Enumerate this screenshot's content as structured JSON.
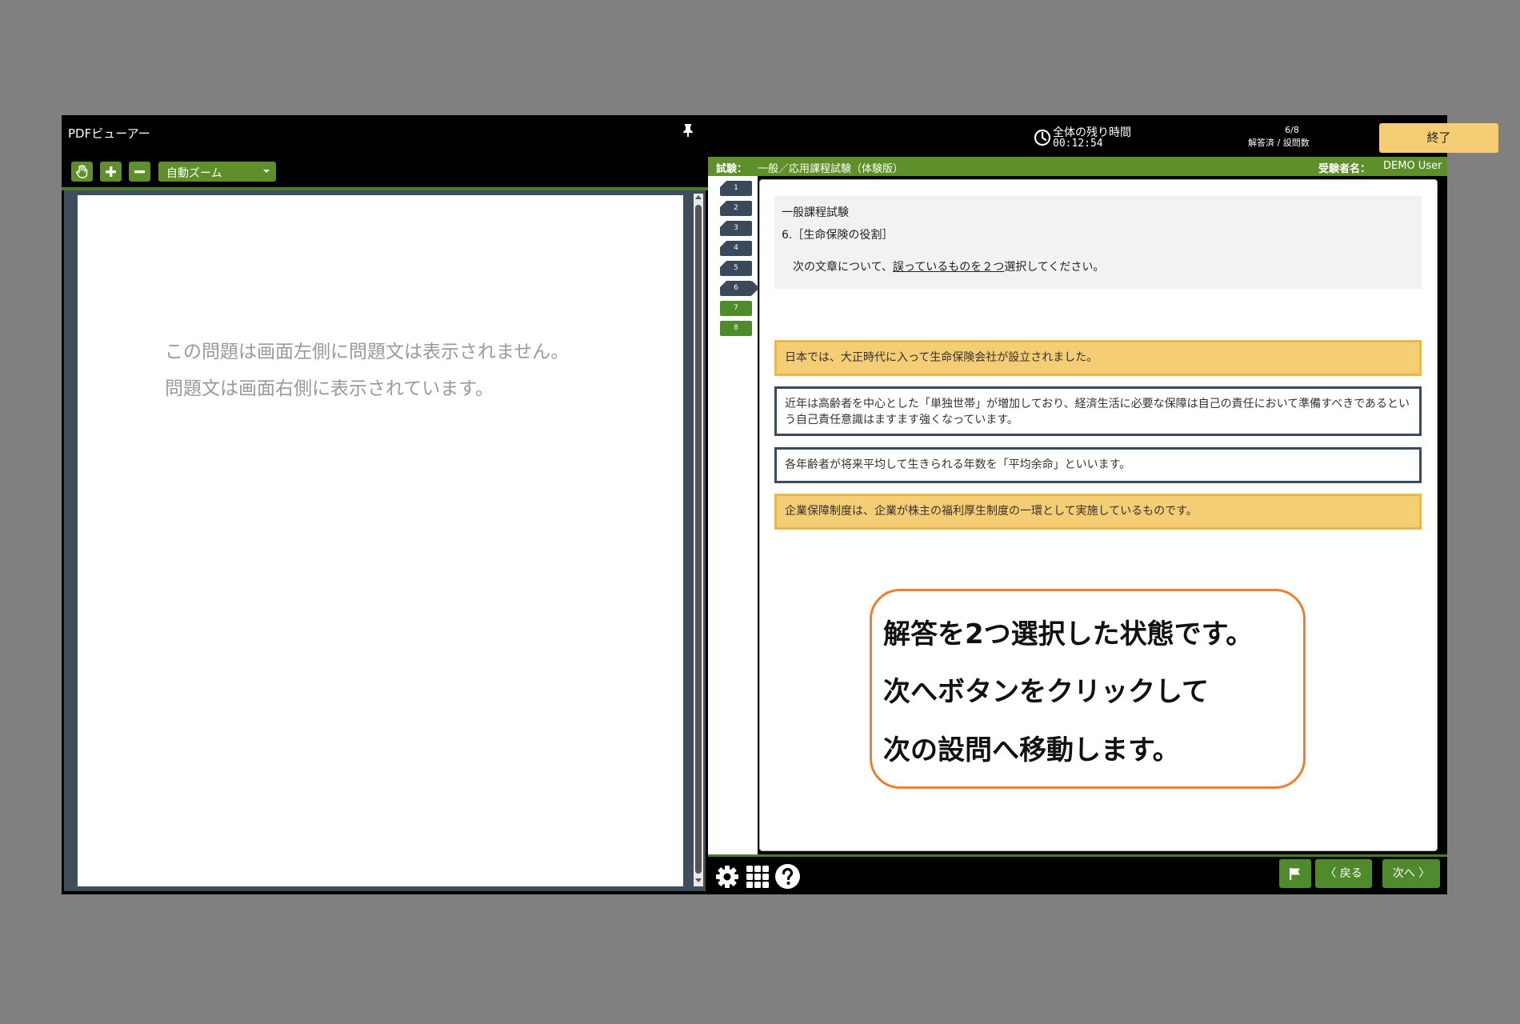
{
  "pdf_viewer": {
    "title": "PDFビューアー",
    "zoom_select": "自動ズーム",
    "message_line1": "この問題は画面左側に問題文は表示されません。",
    "message_line2": "問題文は画面右側に表示されています。"
  },
  "header": {
    "timer_label": "全体の残り時間",
    "timer_value": "00:12:54",
    "progress_count": "6/8",
    "progress_label": "解答済 / 設問数",
    "end_button": "終了"
  },
  "exam_bar": {
    "exam_label": "試験：",
    "exam_name": "一般／応用課程試験（体験版）",
    "examinee_label": "受験者名：",
    "examinee_name": "DEMO User"
  },
  "question_nav": [
    {
      "label": "1",
      "state": "answered"
    },
    {
      "label": "2",
      "state": "answered"
    },
    {
      "label": "3",
      "state": "answered"
    },
    {
      "label": "4",
      "state": "answered"
    },
    {
      "label": "5",
      "state": "answered"
    },
    {
      "label": "6",
      "state": "current"
    },
    {
      "label": "7",
      "state": "pending"
    },
    {
      "label": "8",
      "state": "pending"
    }
  ],
  "question": {
    "category": "一般課程試験",
    "title": "6.［生命保険の役割］",
    "instruction_before": "次の文章について、",
    "instruction_underline": "誤っているものを２つ",
    "instruction_after": "選択してください。"
  },
  "options": [
    {
      "text": "日本では、大正時代に入って生命保険会社が設立されました。",
      "selected": true
    },
    {
      "text": "近年は高齢者を中心とした「単独世帯」が増加しており、経済生活に必要な保障は自己の責任において準備すべきであるという自己責任意識はますます強くなっています。",
      "selected": false
    },
    {
      "text": "各年齢者が将来平均して生きられる年数を「平均余命」といいます。",
      "selected": false
    },
    {
      "text": "企業保障制度は、企業が株主の福利厚生制度の一環として実施しているものです。",
      "selected": true
    }
  ],
  "callout": {
    "line1": "解答を2つ選択した状態です。",
    "line2": "次へボタンをクリックして",
    "line3": "次の設問へ移動します。"
  },
  "footer": {
    "back_button": "〈 戻る",
    "next_button": "次へ 〉"
  },
  "colors": {
    "accent_green": "#5f8f2b",
    "selected_yellow": "#f4cd74",
    "nav_dark": "#3a4a5a",
    "callout_border": "#ef7e2f"
  }
}
